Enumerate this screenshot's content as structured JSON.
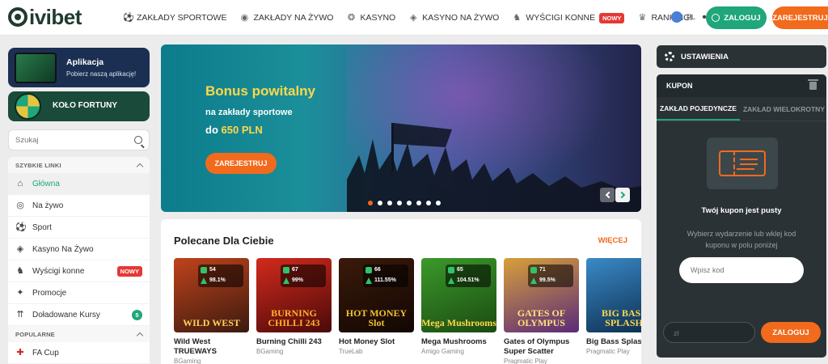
{
  "header": {
    "logo_text": "ivibet",
    "nav": [
      {
        "label": "ZAKŁADY SPORTOWE",
        "icon": "soccer-ball-icon"
      },
      {
        "label": "ZAKŁADY NA ŻYWO",
        "icon": "live-ball-icon"
      },
      {
        "label": "KASYNO",
        "icon": "casino-chip-icon"
      },
      {
        "label": "KASYNO NA ŻYWO",
        "icon": "live-casino-icon"
      },
      {
        "label": "WYŚCIGI KONNE",
        "icon": "horse-icon",
        "badge": "NOWY"
      },
      {
        "label": "RANKINGI",
        "icon": "trophy-icon"
      }
    ],
    "more": "•••",
    "language": "PL",
    "login_label": "ZALOGUJ",
    "register_label": "ZAREJESTRUJ"
  },
  "sidebar": {
    "app_promo": {
      "title": "Aplikacja",
      "subtitle": "Pobierz naszą aplikację!"
    },
    "wheel_promo": {
      "title": "KOŁO FORTUNY"
    },
    "search_placeholder": "Szukaj",
    "quick_links_title": "SZYBKIE LINKI",
    "quick_links": [
      {
        "label": "Główna",
        "icon": "home-icon",
        "active": true
      },
      {
        "label": "Na żywo",
        "icon": "broadcast-icon"
      },
      {
        "label": "Sport",
        "icon": "soccer-ball-icon"
      },
      {
        "label": "Kasyno Na Żywo",
        "icon": "live-casino-icon"
      },
      {
        "label": "Wyścigi konne",
        "icon": "horse-icon",
        "badge": "NOWY"
      },
      {
        "label": "Promocje",
        "icon": "gift-icon"
      },
      {
        "label": "Doładowane Kursy",
        "icon": "boost-icon",
        "count": "5"
      }
    ],
    "popular_title": "POPULARNE",
    "popular": [
      {
        "label": "FA Cup",
        "icon": "england-flag-icon"
      }
    ]
  },
  "banner": {
    "headline": "Bonus powitalny",
    "line2": "na zakłady sportowe",
    "line3_prefix": "do",
    "line3_amount": "650 PLN",
    "cta": "ZAREJESTRUJ",
    "slides": 8,
    "active_slide": 1
  },
  "recommended": {
    "title": "Polecane Dla Ciebie",
    "more": "WIĘCEJ",
    "games": [
      {
        "name": "Wild West TRUEWAYS",
        "provider": "BGaming",
        "art": "WILD WEST",
        "s1": "54",
        "s2": "98.1%",
        "bg1": "#c0431b",
        "bg2": "#3b1a10",
        "art_color": "#ffd25a"
      },
      {
        "name": "Burning Chilli 243",
        "provider": "BGaming",
        "art": "BURNING CHILLI 243",
        "s1": "67",
        "s2": "99%",
        "bg1": "#d32a1d",
        "bg2": "#4a0a08",
        "art_color": "#ffb22e"
      },
      {
        "name": "Hot Money Slot",
        "provider": "TrueLab",
        "art": "HOT MONEY Slot",
        "s1": "66",
        "s2": "111.55%",
        "bg1": "#3a1a0a",
        "bg2": "#120703",
        "art_color": "#f2c230"
      },
      {
        "name": "Mega Mushrooms",
        "provider": "Amigo Gaming",
        "art": "Mega Mushrooms",
        "s1": "65",
        "s2": "104.51%",
        "bg1": "#3b9a2a",
        "bg2": "#1b4a12",
        "art_color": "#ffd84a"
      },
      {
        "name": "Gates of Olympus Super Scatter",
        "provider": "Pragmatic Play",
        "art": "GATES OF OLYMPUS",
        "s1": "71",
        "s2": "99.5%",
        "bg1": "#d8a03a",
        "bg2": "#5a2a7a",
        "art_color": "#ffe27a"
      },
      {
        "name": "Big Bass Splash",
        "provider": "Pragmatic Play",
        "art": "BIG BASS SPLASH",
        "s1": "",
        "s2": "",
        "bg1": "#3a8ac8",
        "bg2": "#0b2a4a",
        "art_color": "#ffd84a"
      }
    ]
  },
  "right_panel": {
    "settings_label": "USTAWIENIA",
    "coupon_title": "KUPON",
    "tabs": [
      "ZAKŁAD POJEDYNCZE",
      "ZAKŁAD WIELOKROTNY"
    ],
    "empty_title": "Twój kupon jest pusty",
    "empty_desc": "Wybierz wydarzenie lub wklej kod kuponu w polu poniżej",
    "code_placeholder": "Wpisz kod",
    "stake_placeholder": "zł",
    "login_label": "ZALOGUJ"
  },
  "colors": {
    "green": "#1fa67a",
    "orange": "#f26a1b",
    "dark": "#2b3236",
    "gold": "#ffd84a"
  }
}
